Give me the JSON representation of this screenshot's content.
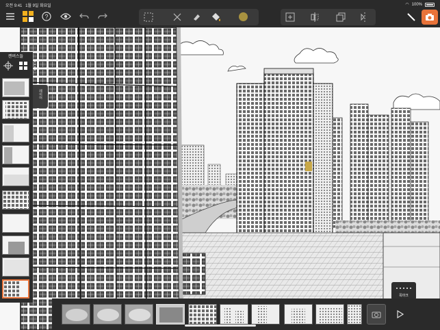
{
  "status_bar": {
    "time": "오전 9:41",
    "date": "1월 9일 화요일",
    "battery": "100%"
  },
  "toolbar": {
    "menu_icon": "hamburger-icon",
    "app_icon": "grid-app-icon",
    "help_icon": "question-icon",
    "view_icon": "eye-icon",
    "undo_icon": "undo-icon",
    "redo_icon": "redo-icon",
    "tool_group": [
      "selection-icon",
      "pen-nib-icon",
      "eraser-icon",
      "fill-bucket-icon"
    ],
    "current_color": "#a89240",
    "transform_group": [
      "add-frame-icon",
      "flip-icon",
      "duplicate-icon",
      "mirror-icon"
    ],
    "active_tool": "pencil-icon",
    "camera_color": "#e8733a"
  },
  "left_panel": {
    "title": "캔버스들",
    "layer_tab_label": "레이어",
    "thumbnail_count": 10,
    "selected_thumbnail": 10
  },
  "bottom_strip": {
    "keypad_label": "목마크",
    "thumbnail_count": 10
  }
}
